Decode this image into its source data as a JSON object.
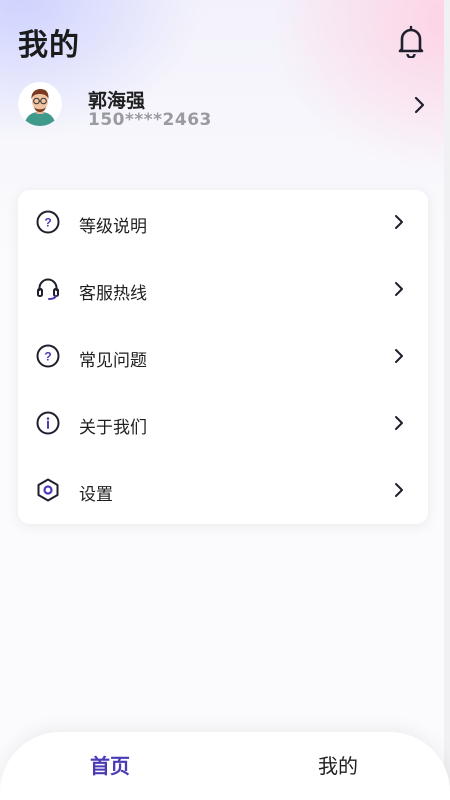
{
  "header": {
    "title": "我的"
  },
  "profile": {
    "name": "郭海强",
    "phone": "150****2463"
  },
  "menu": [
    {
      "label": "等级说明",
      "icon": "question-circle-icon"
    },
    {
      "label": "客服热线",
      "icon": "headset-icon"
    },
    {
      "label": "常见问题",
      "icon": "question-circle-icon"
    },
    {
      "label": "关于我们",
      "icon": "info-circle-icon"
    },
    {
      "label": "设置",
      "icon": "settings-hexagon-icon"
    }
  ],
  "tabbar": {
    "home_label": "首页",
    "mine_label": "我的",
    "active_color": "#4a3bb5",
    "inactive_color": "#1f1f1f"
  },
  "colors": {
    "icon_accent": "#4a3bb5",
    "icon_stroke": "#1f1f2e"
  }
}
